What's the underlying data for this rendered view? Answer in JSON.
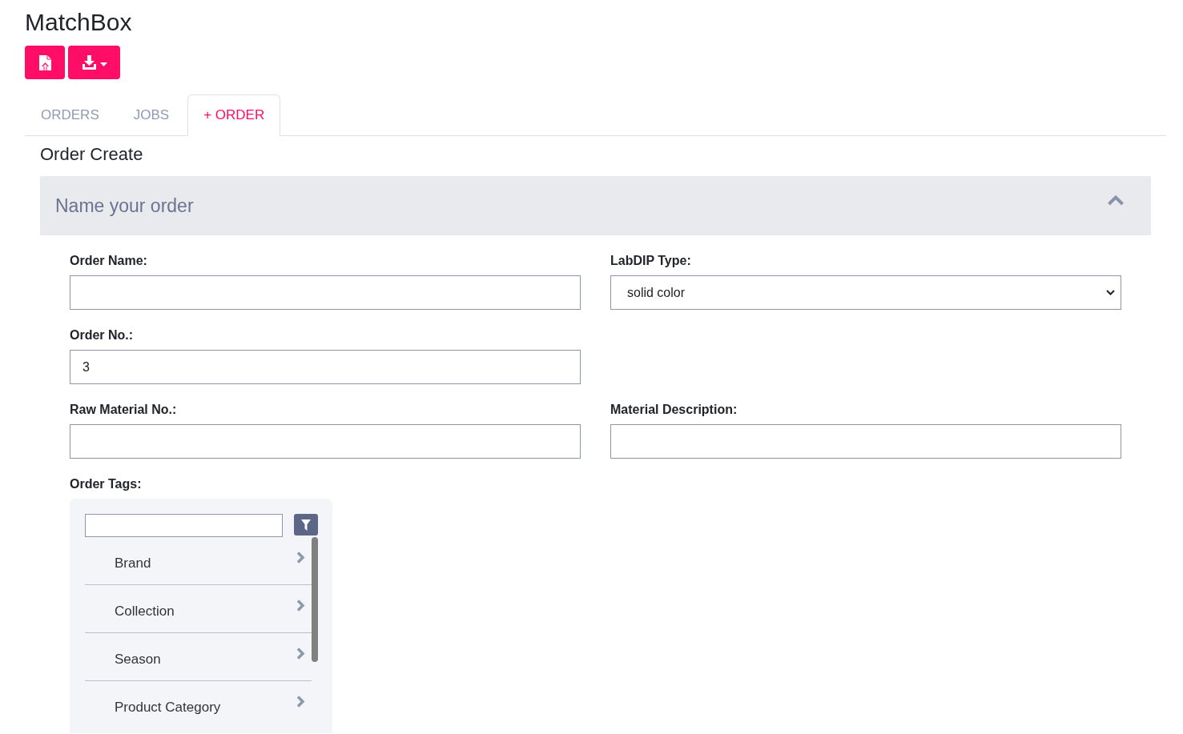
{
  "app_title": "MatchBox",
  "tabs": [
    {
      "label": "ORDERS",
      "selected": false
    },
    {
      "label": "JOBS",
      "selected": false
    },
    {
      "label": "+ ORDER",
      "selected": true
    }
  ],
  "page_heading": "Order Create",
  "section": {
    "title": "Name your order",
    "expanded": true,
    "rows": [
      [
        {
          "kind": "text",
          "label": "Order Name:"
        },
        {
          "kind": "select",
          "label": "LabDIP Type:",
          "value": "solid color"
        }
      ],
      [
        {
          "kind": "text",
          "label": "Order No.:",
          "value": "3"
        }
      ],
      [
        {
          "kind": "text",
          "label": "Raw Material No.:"
        },
        {
          "kind": "text",
          "label": "Material Description:"
        }
      ]
    ],
    "order_tags": {
      "label": "Order Tags:",
      "items": [
        {
          "label": "Brand"
        },
        {
          "label": "Collection"
        },
        {
          "label": "Season"
        },
        {
          "label": "Product Category"
        }
      ]
    }
  }
}
